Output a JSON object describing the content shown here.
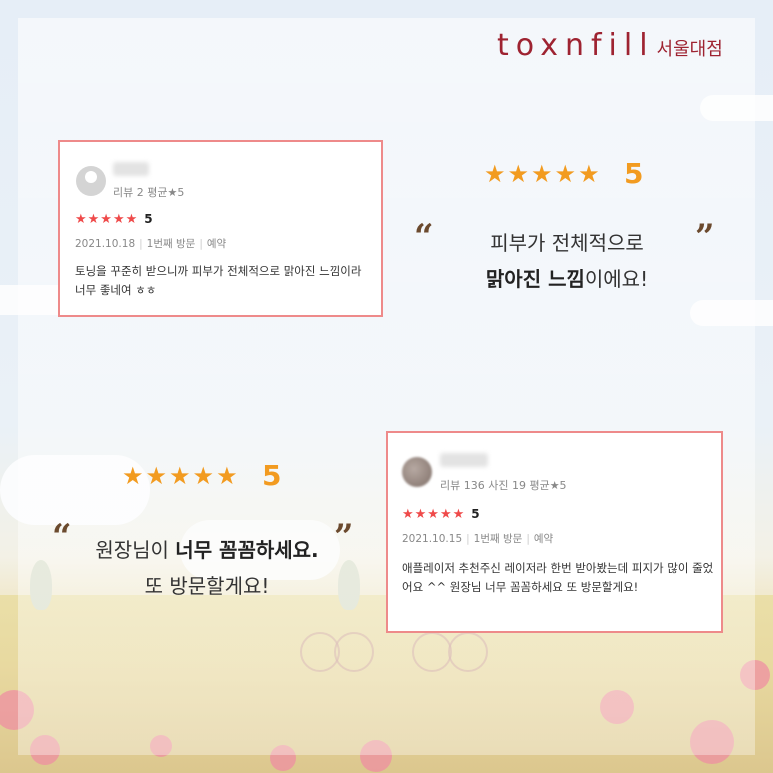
{
  "brand": {
    "logo": "toxnfill",
    "branch": "서울대점",
    "color": "#9e2331"
  },
  "review1": {
    "meta": "리뷰 2   평균★5",
    "stars": "★★★★★",
    "score": "5",
    "date": "2021.10.18",
    "visit": "1번째 방문",
    "type": "예약",
    "text": "토닝을 꾸준히 받으니까 피부가 전체적으로 맑아진 느낌이라 너무 좋네여 ㅎㅎ"
  },
  "highlight1": {
    "stars": "★★★★★",
    "score": "5",
    "open_quote": "“",
    "close_quote": "”",
    "line1": "피부가 전체적으로",
    "line2_bold": "맑아진 느낌",
    "line2_rest": "이에요!"
  },
  "highlight2": {
    "stars": "★★★★★",
    "score": "5",
    "open_quote": "“",
    "close_quote": "”",
    "line1_pre": "원장님이 ",
    "line1_bold": "너무 꼼꼼하세요.",
    "line2": "또 방문할게요!"
  },
  "review2": {
    "meta": "리뷰 136   사진 19   평균★5",
    "stars": "★★★★★",
    "score": "5",
    "date": "2021.10.15",
    "visit": "1번째 방문",
    "type": "예약",
    "text": "애플레이저 추천주신 레이저라 한번 받아봤는데 피지가 많이 줄었어요 ^^ 원장님 너무 꼼꼼하세요 또 방문할게요!"
  },
  "colors": {
    "card_border": "#ee8a8a",
    "review_star": "#ef4a4a",
    "highlight_star": "#f29b20"
  }
}
